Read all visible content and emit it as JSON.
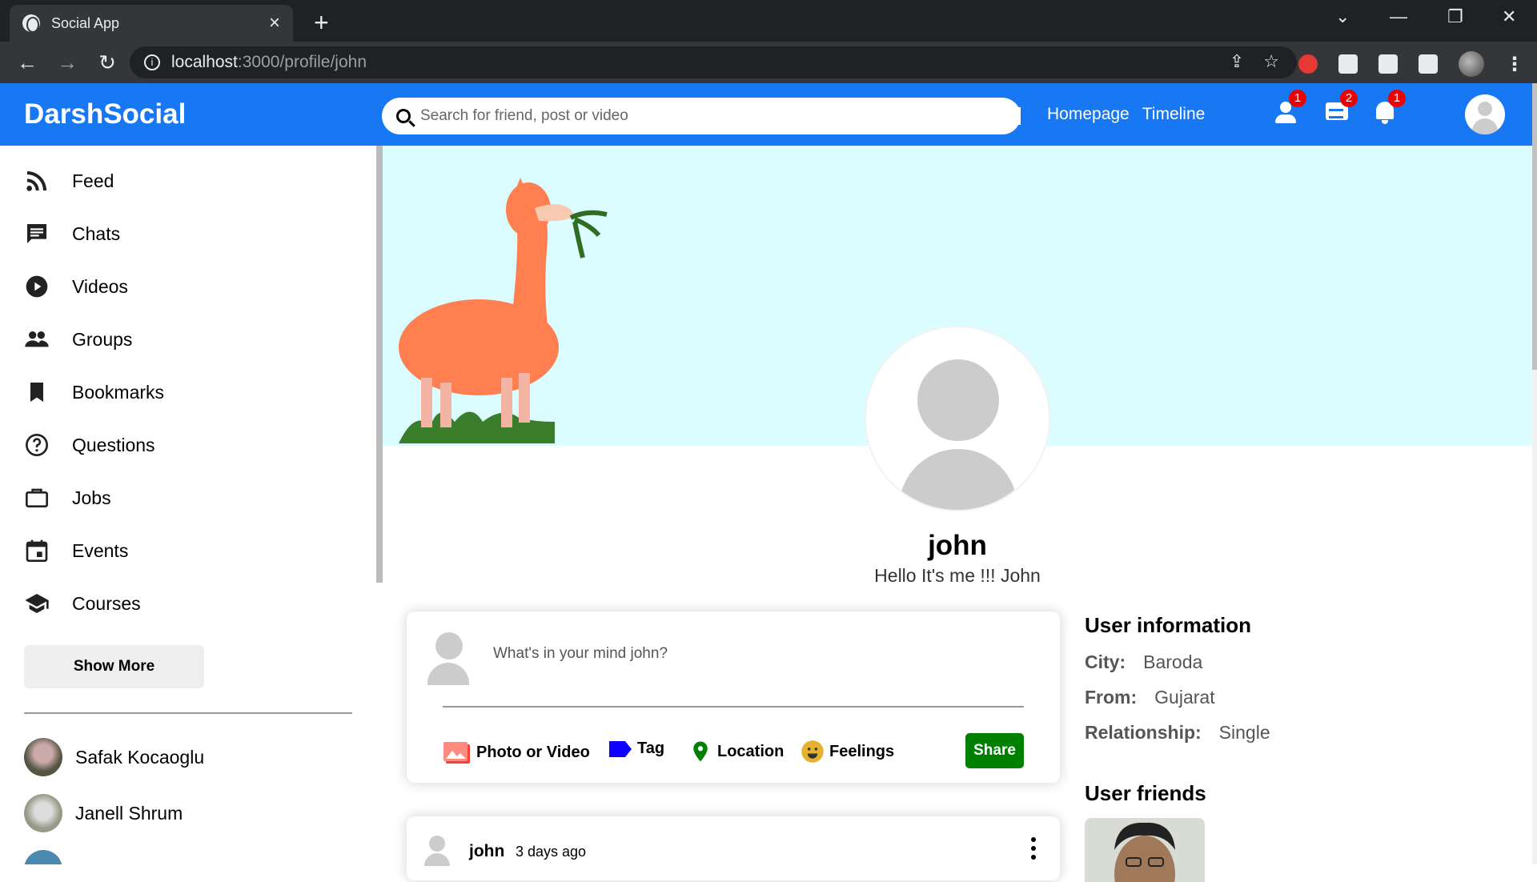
{
  "browser": {
    "tab_title": "Social App",
    "url_host": "localhost",
    "url_path": ":3000/profile/john"
  },
  "topbar": {
    "logo": "DarshSocial",
    "search_placeholder": "Search for friend, post or video",
    "links": [
      "Homepage",
      "Timeline"
    ],
    "badges": {
      "friends": "1",
      "messages": "2",
      "notifications": "1"
    },
    "brand_color": "#1877f2"
  },
  "sidebar": {
    "items": [
      {
        "label": "Feed",
        "icon": "rss-icon"
      },
      {
        "label": "Chats",
        "icon": "chat-icon"
      },
      {
        "label": "Videos",
        "icon": "play-circle-icon"
      },
      {
        "label": "Groups",
        "icon": "group-icon"
      },
      {
        "label": "Bookmarks",
        "icon": "bookmark-icon"
      },
      {
        "label": "Questions",
        "icon": "help-circle-icon"
      },
      {
        "label": "Jobs",
        "icon": "briefcase-icon"
      },
      {
        "label": "Events",
        "icon": "calendar-icon"
      },
      {
        "label": "Courses",
        "icon": "school-icon"
      }
    ],
    "show_more": "Show More",
    "friends": [
      "Safak Kocaoglu",
      "Janell Shrum"
    ]
  },
  "profile": {
    "name": "john",
    "description": "Hello It's me !!! John"
  },
  "share": {
    "placeholder": "What's in your mind john?",
    "options": [
      "Photo or Video",
      "Tag",
      "Location",
      "Feelings"
    ],
    "button": "Share"
  },
  "post": {
    "username": "john",
    "time": "3 days ago"
  },
  "user_info": {
    "title": "User information",
    "rows": [
      {
        "key": "City:",
        "value": "Baroda"
      },
      {
        "key": "From:",
        "value": "Gujarat"
      },
      {
        "key": "Relationship:",
        "value": "Single"
      }
    ],
    "friends_title": "User friends"
  }
}
